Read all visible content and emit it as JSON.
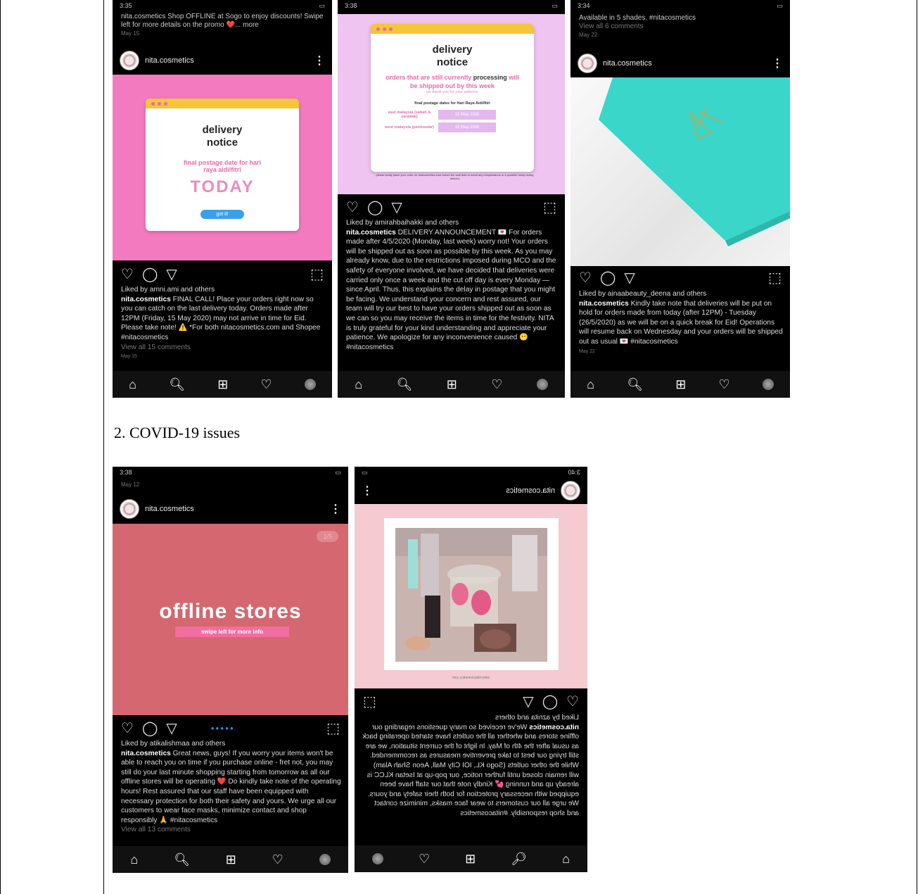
{
  "section_heading": "2. COVID-19 issues",
  "posts": {
    "p1": {
      "status_time": "3:35",
      "prev_caption": "nita.cosmetics Shop OFFLINE at Sogo to enjoy discounts! Swipe left for more details on the promo ❤️... more",
      "prev_date": "May 15",
      "username": "nita.cosmetics",
      "card_title": "delivery notice",
      "card_sub": "final postage date for hari raya aidilfitri",
      "card_big": "TODAY",
      "card_btn": "got it!",
      "liked": "Liked by amni.ami and others",
      "cap_user": "nita.cosmetics",
      "caption": "FINAL CALL! Place your orders right now so you can catch on the last delivery today. Orders made after 12PM (Friday, 15 May 2020) may not arrive in time for Eid. Please take note! ⚠️ *For both nitacosmetics.com and Shopee #nitacosmetics",
      "comments": "View all 15 comments",
      "date": "May 15"
    },
    "p2": {
      "status_time": "3:38",
      "card_title": "delivery notice",
      "card_l1": "orders that are still currently",
      "card_l1b": "processing",
      "card_l1c": "will be shipped out by this week",
      "card_thanks": "we thank you for your patience",
      "card_final": "final postage dates for Hari Raya Aidilfitri",
      "east": "east malaysia (sabah & sarawak)",
      "east_date": "10 May 2020",
      "west": "west malaysia (peninsular)",
      "west_date": "15 May 2020",
      "card_foot": "please kindly place your order on nitacosmetics.com before the said date to avoid any complications or a possible delay during delivery",
      "liked": "Liked by amirahbaihakki and others",
      "cap_user": "nita.cosmetics",
      "caption": "DELIVERY ANNOUNCEMENT 💌 For orders made after 4/5/2020 (Monday, last week) worry not! Your orders will be shipped out as soon as possible by this week. As you may already know, due to the restrictions imposed during MCO and the safety of everyone involved, we have decided that deliveries were carried only once a week and the cut off day is every Monday — since April. Thus, this explains the delay in postage that you might be facing. We understand your concern and rest assured, our team will try our best to have your orders shipped out as soon as we can so you may receive the items in time for the festivity. NITA is truly grateful for your kind understanding and appreciate your patience. We apologize for any inconvenience caused 😶 #nitacosmetics"
    },
    "p3": {
      "status_time": "3:34",
      "prev_caption": "Available in 5 shades. #nitacosmetics",
      "prev_comments": "View all 6 comments",
      "prev_date": "May 22",
      "username": "nita.cosmetics",
      "liked": "Liked by ainaabeauty_deena and others",
      "cap_user": "nita.cosmetics",
      "caption": "Kindly take note that deliveries will be put on hold for orders made from today (after 12PM) - Tuesday (26/5/2020) as we will be on a quick break for Eid! Operations will resume back on Wednesday and your orders will be shipped out as usual 💌 #nitacosmetics",
      "date": "May 22"
    },
    "p4": {
      "status_time": "3:38",
      "prev_date": "May 12",
      "username": "nita.cosmetics",
      "counter": "1/5",
      "big": "offline stores",
      "sub": "swipe left for more info",
      "liked": "Liked by atikalishmaa and others",
      "cap_user": "nita.cosmetics",
      "caption": "Great news, guys! If you worry your items won't be able to reach you on time if you purchase online - fret not, you may still do your last minute shopping starting from tomorrow as all our offline stores will be operating ❤️ Do kindly take note of the operating hours! Rest assured that our staff have been equipped with necessary protection for both their safety and yours. We urge all our customers to wear face masks, minimize contact and shop responsibly 🙏 #nitacosmetics",
      "comments": "View all 13 comments"
    },
    "p5": {
      "status_time": "3:40",
      "username": "nita.cosmetics",
      "liked": "Liked by aznita and others",
      "cap_user": "nita.cosmetics",
      "caption": "We've received so many questions regarding our offline stores and whether all the outlets have started operating back as usual after the 4th of May. In light of the current situation, we are still trying our best to take preventive measures as recommended. While the other outlets (Sogo KL, IOI City Mall, Aeon Shah Alam) will remain closed until further notice, our pop-up at Isetan KLCC is already up and running 💕 Kindly note that our staff have been equipped with necessary protection for both their safety and yours. We urge all our customers to wear face masks, minimize contact and shop responsibly. #nitacosmetics",
      "web": "www.nitacosmetics.com"
    }
  },
  "icons": {
    "heart": "♡",
    "comment": "◯",
    "send": "▽",
    "bookmark": "⊓",
    "home": "⌂",
    "search": "⚲",
    "add": "⊞"
  },
  "colors": {
    "pink": "#f47ac0",
    "lavender": "#efc4f0",
    "teal": "#39d6c9",
    "rose": "#d4676f",
    "blush": "#f5cad1"
  }
}
